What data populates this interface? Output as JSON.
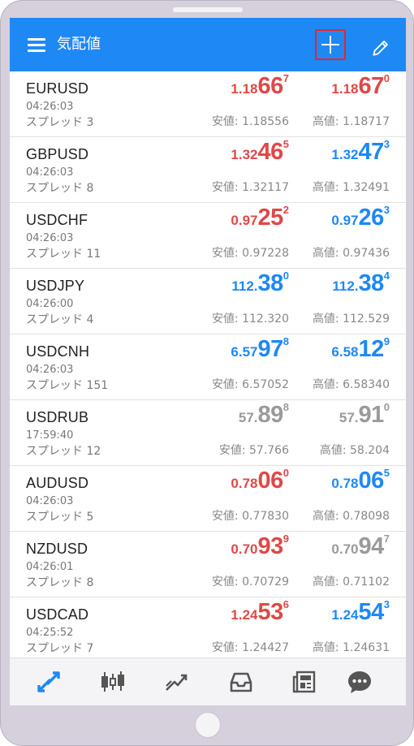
{
  "header": {
    "title": "気配値",
    "menu_icon": "hamburger-icon",
    "add_icon": "plus-icon",
    "edit_icon": "pencil-icon",
    "accent_color": "#1e88f5",
    "highlight_color": "#e8262b"
  },
  "colors": {
    "up": "#1e88f5",
    "down": "#e04848",
    "neutral": "#9a9a9a"
  },
  "quotes": [
    {
      "symbol": "EURUSD",
      "time": "04:26:03",
      "spread": "スプレッド 3",
      "bid": {
        "small": "1.18",
        "big": "66",
        "sup": "7",
        "color": "down"
      },
      "ask": {
        "small": "1.18",
        "big": "67",
        "sup": "0",
        "color": "down"
      },
      "low": "安値: 1.18556",
      "high": "高値: 1.18717"
    },
    {
      "symbol": "GBPUSD",
      "time": "04:26:03",
      "spread": "スプレッド 8",
      "bid": {
        "small": "1.32",
        "big": "46",
        "sup": "5",
        "color": "down"
      },
      "ask": {
        "small": "1.32",
        "big": "47",
        "sup": "3",
        "color": "up"
      },
      "low": "安値: 1.32117",
      "high": "高値: 1.32491"
    },
    {
      "symbol": "USDCHF",
      "time": "04:26:03",
      "spread": "スプレッド 11",
      "bid": {
        "small": "0.97",
        "big": "25",
        "sup": "2",
        "color": "down"
      },
      "ask": {
        "small": "0.97",
        "big": "26",
        "sup": "3",
        "color": "up"
      },
      "low": "安値: 0.97228",
      "high": "高値: 0.97436"
    },
    {
      "symbol": "USDJPY",
      "time": "04:26:00",
      "spread": "スプレッド 4",
      "bid": {
        "small": "112.",
        "big": "38",
        "sup": "0",
        "color": "up"
      },
      "ask": {
        "small": "112.",
        "big": "38",
        "sup": "4",
        "color": "up"
      },
      "low": "安値: 112.320",
      "high": "高値: 112.529"
    },
    {
      "symbol": "USDCNH",
      "time": "04:26:03",
      "spread": "スプレッド 151",
      "bid": {
        "small": "6.57",
        "big": "97",
        "sup": "8",
        "color": "up"
      },
      "ask": {
        "small": "6.58",
        "big": "12",
        "sup": "9",
        "color": "up"
      },
      "low": "安値: 6.57052",
      "high": "高値: 6.58340"
    },
    {
      "symbol": "USDRUB",
      "time": "17:59:40",
      "spread": "スプレッド 12",
      "bid": {
        "small": "57.",
        "big": "89",
        "sup": "8",
        "color": "neutral"
      },
      "ask": {
        "small": "57.",
        "big": "91",
        "sup": "0",
        "color": "neutral"
      },
      "low": "安値: 57.766",
      "high": "高値: 58.204"
    },
    {
      "symbol": "AUDUSD",
      "time": "04:26:03",
      "spread": "スプレッド 5",
      "bid": {
        "small": "0.78",
        "big": "06",
        "sup": "0",
        "color": "down"
      },
      "ask": {
        "small": "0.78",
        "big": "06",
        "sup": "5",
        "color": "up"
      },
      "low": "安値: 0.77830",
      "high": "高値: 0.78098"
    },
    {
      "symbol": "NZDUSD",
      "time": "04:26:01",
      "spread": "スプレッド 8",
      "bid": {
        "small": "0.70",
        "big": "93",
        "sup": "9",
        "color": "down"
      },
      "ask": {
        "small": "0.70",
        "big": "94",
        "sup": "7",
        "color": "neutral"
      },
      "low": "安値: 0.70729",
      "high": "高値: 0.71102"
    },
    {
      "symbol": "USDCAD",
      "time": "04:25:52",
      "spread": "スプレッド 7",
      "bid": {
        "small": "1.24",
        "big": "53",
        "sup": "6",
        "color": "down"
      },
      "ask": {
        "small": "1.24",
        "big": "54",
        "sup": "3",
        "color": "up"
      },
      "low": "安値: 1.24427",
      "high": "高値: 1.24631"
    }
  ],
  "tabs": [
    {
      "id": "quotes",
      "icon": "quotes-arrows-icon",
      "active": true
    },
    {
      "id": "chart",
      "icon": "candlestick-icon",
      "active": false
    },
    {
      "id": "trade",
      "icon": "trade-chart-icon",
      "active": false
    },
    {
      "id": "history",
      "icon": "inbox-icon",
      "active": false
    },
    {
      "id": "news",
      "icon": "newspaper-icon",
      "active": false
    },
    {
      "id": "chat",
      "icon": "chat-bubble-icon",
      "active": false
    }
  ]
}
